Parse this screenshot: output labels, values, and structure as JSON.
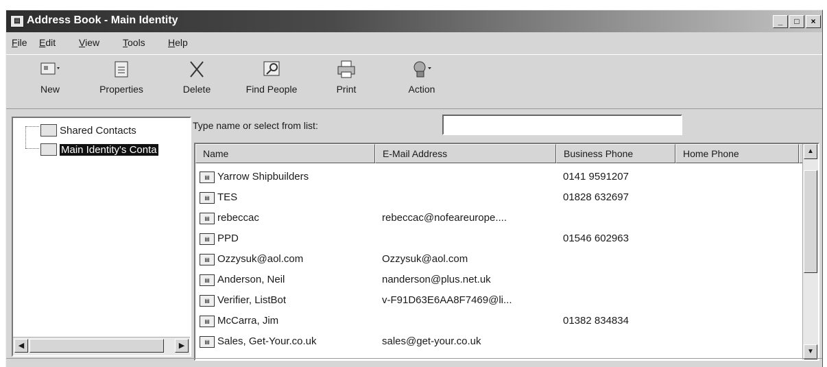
{
  "window": {
    "title": "Address Book - Main Identity",
    "title_icon": "address-book-icon",
    "controls": [
      "_",
      "□",
      "×"
    ]
  },
  "menu": [
    {
      "pre": "",
      "u": "F",
      "post": "ile"
    },
    {
      "pre": "",
      "u": "E",
      "post": "dit"
    },
    {
      "pre": "",
      "u": "V",
      "post": "iew"
    },
    {
      "pre": "",
      "u": "T",
      "post": "ools"
    },
    {
      "pre": "",
      "u": "H",
      "post": "elp"
    }
  ],
  "toolbar": {
    "new": "New",
    "properties": "Properties",
    "delete": "Delete",
    "find_people": "Find People",
    "print": "Print",
    "action": "Action"
  },
  "tree": {
    "shared": "Shared Contacts",
    "main": "Main Identity's Conta"
  },
  "search": {
    "label": "Type name or select from list:",
    "value": ""
  },
  "columns": {
    "name": "Name",
    "email": "E-Mail Address",
    "business_phone": "Business Phone",
    "home_phone": "Home Phone"
  },
  "contacts": [
    {
      "name": "Yarrow Shipbuilders",
      "email": "",
      "business_phone": "0141 9591207",
      "home_phone": ""
    },
    {
      "name": "TES",
      "email": "",
      "business_phone": "01828 632697",
      "home_phone": ""
    },
    {
      "name": "rebeccac",
      "email": "rebeccac@nofeareurope....",
      "business_phone": "",
      "home_phone": ""
    },
    {
      "name": "PPD",
      "email": "",
      "business_phone": "01546 602963",
      "home_phone": ""
    },
    {
      "name": "Ozzysuk@aol.com",
      "email": "Ozzysuk@aol.com",
      "business_phone": "",
      "home_phone": ""
    },
    {
      "name": "Anderson, Neil",
      "email": "nanderson@plus.net.uk",
      "business_phone": "",
      "home_phone": ""
    },
    {
      "name": "Verifier, ListBot",
      "email": "v-F91D63E6AA8F7469@li...",
      "business_phone": "",
      "home_phone": ""
    },
    {
      "name": "McCarra, Jim",
      "email": "",
      "business_phone": "01382 834834",
      "home_phone": ""
    },
    {
      "name": "Sales, Get-Your.co.uk",
      "email": "sales@get-your.co.uk",
      "business_phone": "",
      "home_phone": ""
    }
  ]
}
